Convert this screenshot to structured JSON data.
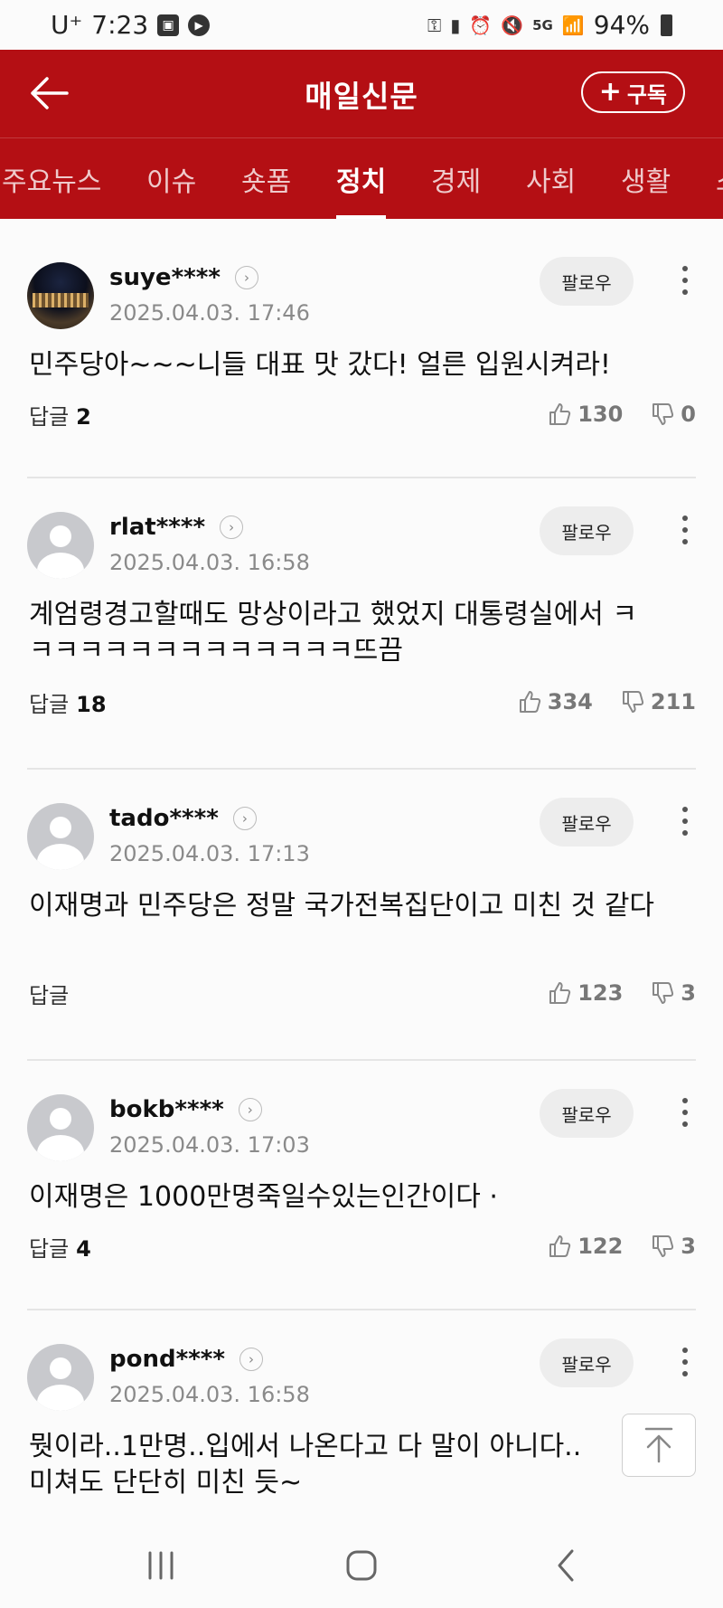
{
  "status_bar": {
    "carrier": "U⁺",
    "time": "7:23",
    "network": "5G",
    "battery": "94%"
  },
  "header": {
    "title": "매일신문",
    "subscribe_label": "구독"
  },
  "tabs": [
    {
      "label": "주요뉴스",
      "active": false
    },
    {
      "label": "이슈",
      "active": false
    },
    {
      "label": "숏폼",
      "active": false
    },
    {
      "label": "정치",
      "active": true
    },
    {
      "label": "경제",
      "active": false
    },
    {
      "label": "사회",
      "active": false
    },
    {
      "label": "생활",
      "active": false
    },
    {
      "label": "스",
      "active": false
    }
  ],
  "follow_label": "팔로우",
  "reply_label": "답글",
  "comments": [
    {
      "user": "suye****",
      "date": "2025.04.03. 17:46",
      "text": "민주당아~~~니들 대표 맛 갔다! 얼른 입원시켜라!",
      "replies": "2",
      "likes": "130",
      "dislikes": "0",
      "avatar": "photo"
    },
    {
      "user": "rlat****",
      "date": "2025.04.03. 16:58",
      "text": "계엄령경고할때도 망상이라고 했었지 대통령실에서 ㅋㅋㅋㅋㅋㅋㅋㅋㅋㅋㅋㅋㅋㅋ뜨끔",
      "replies": "18",
      "likes": "334",
      "dislikes": "211",
      "avatar": "default"
    },
    {
      "user": "tado****",
      "date": "2025.04.03. 17:13",
      "text": "이재명과 민주당은 정말 국가전복집단이고 미친 것 같다",
      "replies": "",
      "likes": "123",
      "dislikes": "3",
      "avatar": "default"
    },
    {
      "user": "bokb****",
      "date": "2025.04.03. 17:03",
      "text": "이재명은 1000만명죽일수있는인간이다 ·",
      "replies": "4",
      "likes": "122",
      "dislikes": "3",
      "avatar": "default"
    },
    {
      "user": "pond****",
      "date": "2025.04.03. 16:58",
      "text": "뭣이라..1만명..입에서 나온다고 다 말이 아니다.. 미쳐도 단단히 미친 듯~",
      "replies": "",
      "likes": "",
      "dislikes": "",
      "avatar": "default"
    }
  ],
  "colors": {
    "brand": "#b40f14",
    "background": "#fbfbfb"
  }
}
